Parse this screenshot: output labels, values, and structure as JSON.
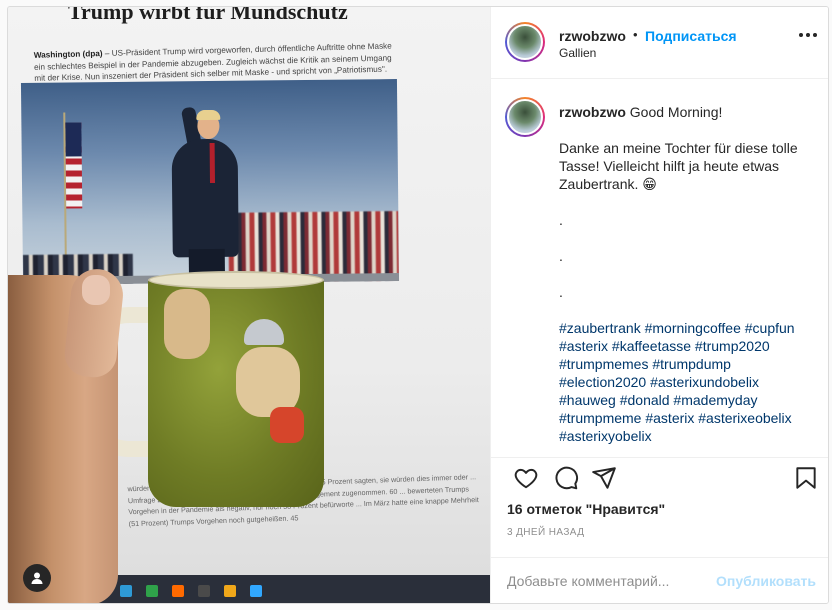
{
  "photo": {
    "headline": "Trump wirbt für Mundschutz",
    "article_lead_dateline": "Washington (dpa)",
    "article_lead_text": " – US-Präsident Trump wird vorgeworfen, durch öffentliche Auftritte ohne Maske ein schlechtes Beispiel in der Pandemie abzugeben. Zugleich wächst die Kritik an seinem Umgang mit der Krise. Nun inszeniert der Präsident sich selber mit Maske - und spricht von „Patriotismus\".",
    "article_lower_text": "würden in Gegenwart anderer ... eine Schutzmaske tragen. 15 Prozent sagten, sie würden dies immer oder ... Umfrage zufolge hat auch die Kritik an Trumps Krisenmanagement zugenommen. 60 ... bewerteten Trumps Vorgehen in der Pandemie als negativ, nur noch 38 Prozent befürworte ... Im März hatte eine knappe Mehrheit (51 Prozent) Trumps Vorgehen noch gutgeheißen. 45"
  },
  "post": {
    "username": "rzwobzwo",
    "follow_label": "Подписаться",
    "location": "Gallien",
    "caption_greeting": "Good Morning!",
    "caption_text": "Danke an meine Tochter für diese tolle Tasse! Vielleicht hilft ja heute etwas Zaubertrank. 😁",
    "dot1": ".",
    "dot2": ".",
    "dot3": ".",
    "hashtags": "#zaubertrank #morningcoffee #cupfun #asterix #kaffeetasse #trump2020 #trumpmemes #trumpdump #election2020 #asterixundobelix #hauweg #donald #mademyday #trumpmeme #asterix #asterixeobelix #asterixyobelix",
    "likes": "16 отметок \"Нравится\"",
    "timestamp": "3 ДНЕЙ НАЗАД",
    "comment_placeholder": "Добавьте комментарий...",
    "publish_label": "Опубликовать"
  },
  "colors": {
    "accent": "#0095f6",
    "hashtag": "#00376b",
    "publish_disabled": "#b2dffc"
  },
  "icons": [
    "more-horizontal-icon",
    "heart-icon",
    "comment-icon",
    "share-icon",
    "bookmark-icon",
    "user-tag-icon"
  ]
}
